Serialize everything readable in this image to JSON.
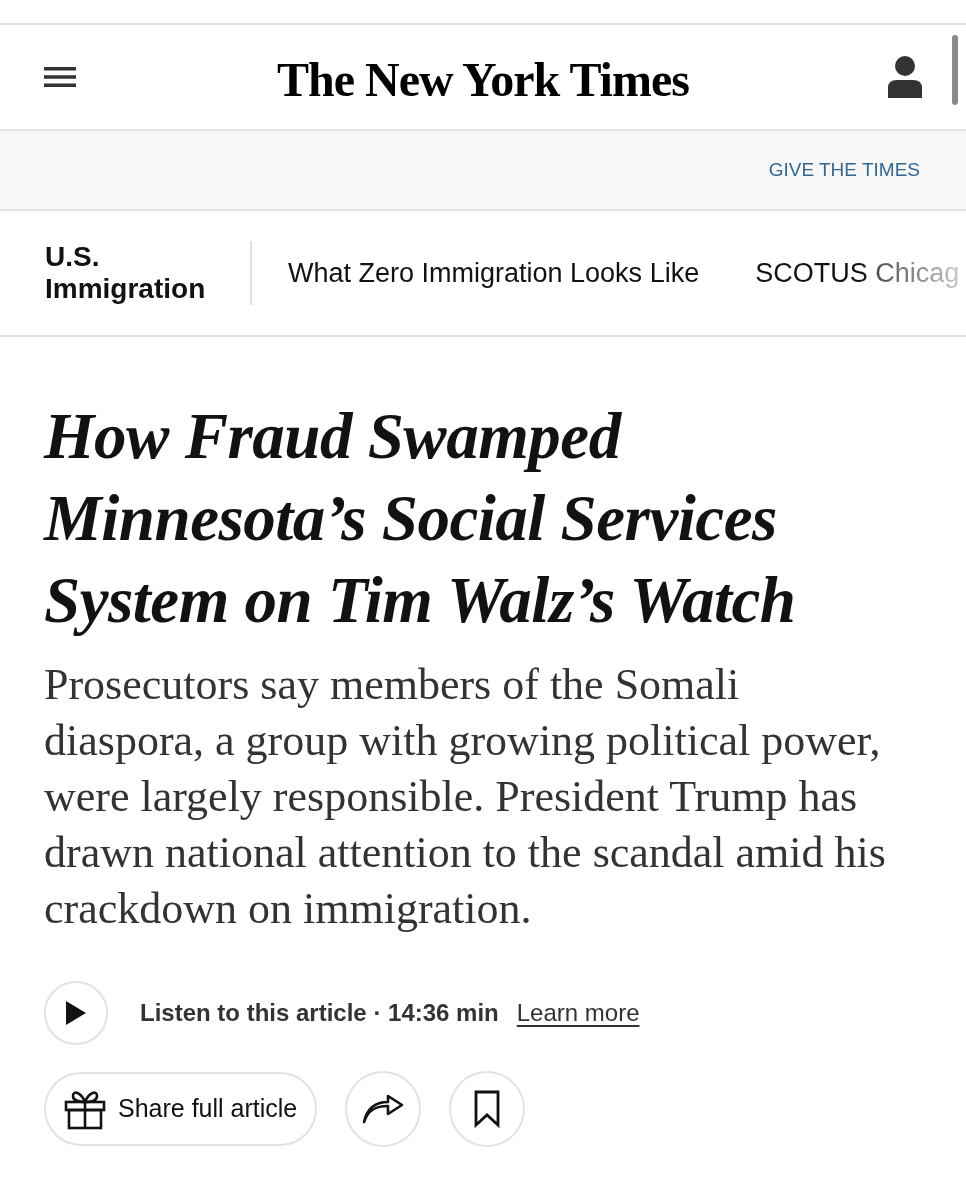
{
  "header": {
    "logo": "The New York Times"
  },
  "promo_bar": {
    "link": "GIVE THE TIMES"
  },
  "topic_nav": {
    "section": "U.S. Immigration",
    "links": [
      "What Zero Immigration Looks Like",
      "SCOTUS Chicag"
    ]
  },
  "article": {
    "headline": "How Fraud Swamped Minnesota’s Social Services System on Tim Walz’s Watch",
    "summary": "Prosecutors say members of the Somali diaspora, a group with growing political power, were largely responsible. President Trump has drawn national attention to the scandal amid his crackdown on immigration.",
    "audio": {
      "label": "Listen to this article · 14:36 min",
      "link": "Learn more"
    },
    "actions": [
      {
        "kind": "gift",
        "label": "Share full article"
      },
      {
        "kind": "share"
      },
      {
        "kind": "save"
      }
    ]
  }
}
